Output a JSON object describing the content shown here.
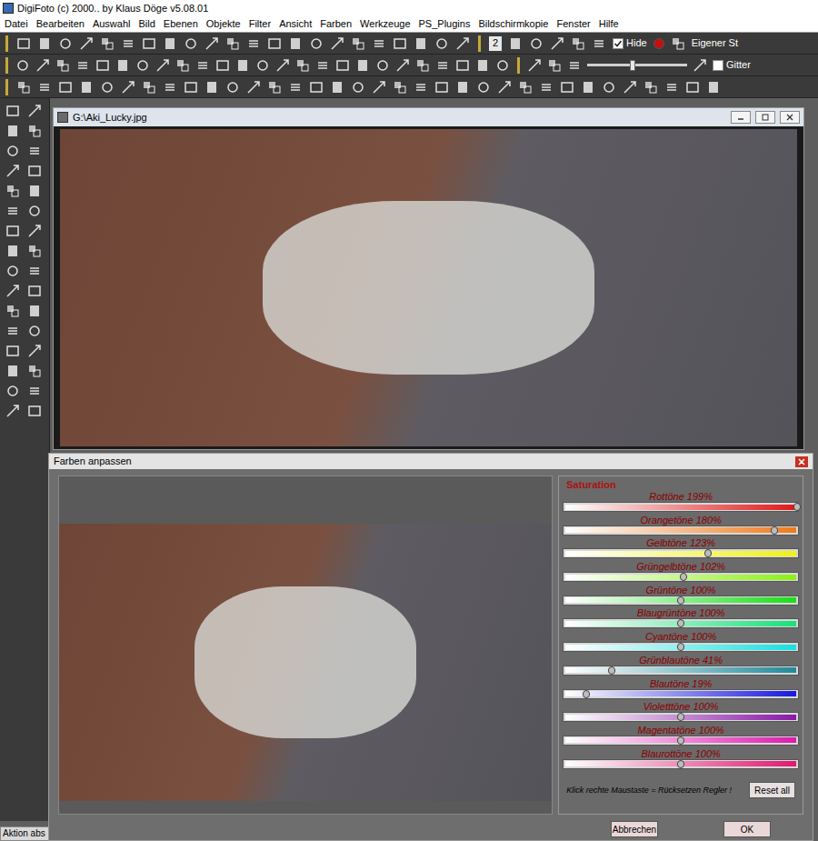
{
  "app": {
    "title": "DigiFoto (c) 2000.. by Klaus Döge v5.08.01"
  },
  "menu": [
    "Datei",
    "Bearbeiten",
    "Auswahl",
    "Bild",
    "Ebenen",
    "Objekte",
    "Filter",
    "Ansicht",
    "Farben",
    "Werkzeuge",
    "PS_Plugins",
    "Bildschirmkopie",
    "Fenster",
    "Hilfe"
  ],
  "toolbar": {
    "page": "2",
    "hide": {
      "label": "Hide",
      "checked": true
    },
    "style": "Eigener St",
    "zoom": {
      "level": 0.45
    },
    "grid": {
      "label": "Gitter",
      "checked": false
    }
  },
  "image_window": {
    "title": "G:\\Aki_Lucky.jpg"
  },
  "dialog": {
    "title": "Farben anpassen",
    "section": "Saturation",
    "sliders": [
      {
        "label": "Rottöne 199%",
        "level": 0.995,
        "color": "#e01818"
      },
      {
        "label": "Orangetöne 180%",
        "level": 0.9,
        "color": "#f07a18"
      },
      {
        "label": "Gelbtöne 123%",
        "level": 0.615,
        "color": "#f0f018"
      },
      {
        "label": "Grüngelbtöne 102%",
        "level": 0.51,
        "color": "#8cf018"
      },
      {
        "label": "Grüntöne 100%",
        "level": 0.5,
        "color": "#18e018"
      },
      {
        "label": "Blaugrüntöne 100%",
        "level": 0.5,
        "color": "#18e07a"
      },
      {
        "label": "Cyantöne 100%",
        "level": 0.5,
        "color": "#18e0e0"
      },
      {
        "label": "Grünblautöne 41%",
        "level": 0.205,
        "color": "#208a9a"
      },
      {
        "label": "Blautöne 19%",
        "level": 0.095,
        "color": "#1818e0"
      },
      {
        "label": "Violetttöne 100%",
        "level": 0.5,
        "color": "#8a18a8"
      },
      {
        "label": "Magentatöne 100%",
        "level": 0.5,
        "color": "#e018b0"
      },
      {
        "label": "Blaurottöne 100%",
        "level": 0.5,
        "color": "#e01870"
      }
    ],
    "hint": "Klick rechte Maustaste = Rücksetzen Regler !",
    "reset": "Reset all",
    "buttons": [
      "Abbrechen",
      "OK"
    ]
  },
  "status_bar": "Aktion abs"
}
